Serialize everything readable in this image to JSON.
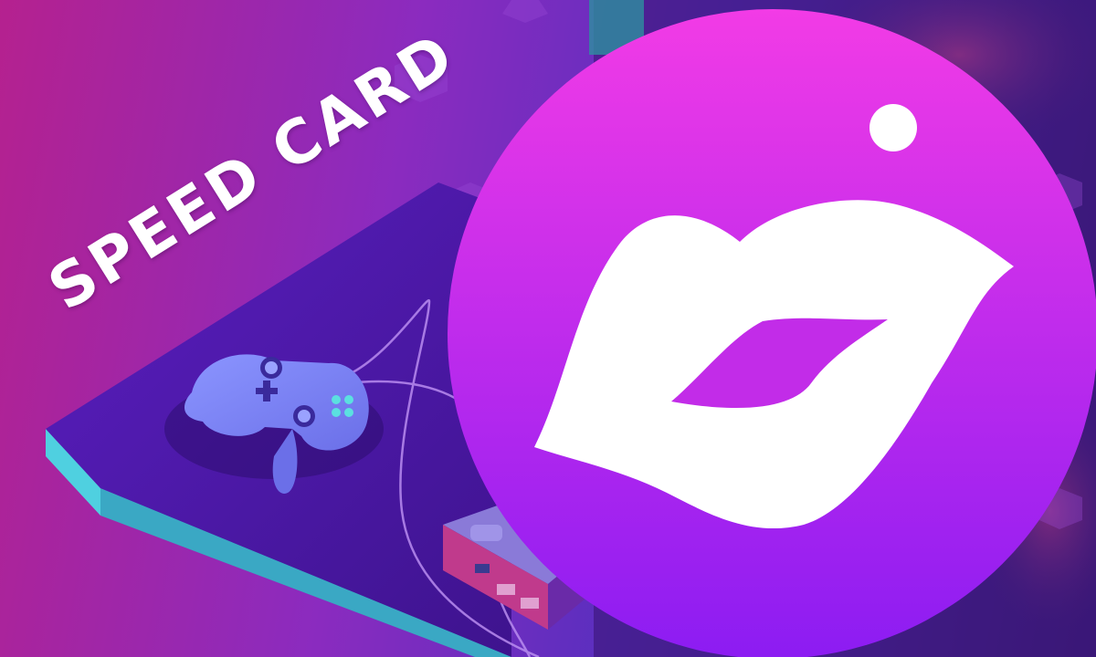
{
  "title": "SPEED CARD",
  "icons": [
    "app-logo-icon",
    "lips-icon",
    "gamepad-icon",
    "game-console-icon"
  ],
  "colors": {
    "bg_left": "#b5218f",
    "bg_right": "#3a1a78",
    "platform": "#4b1aa8",
    "platform_edge": "#5bc8d8",
    "logo_top": "#ee38e6",
    "logo_bottom": "#8a1cf0",
    "gamepad": "#7c86f5"
  }
}
